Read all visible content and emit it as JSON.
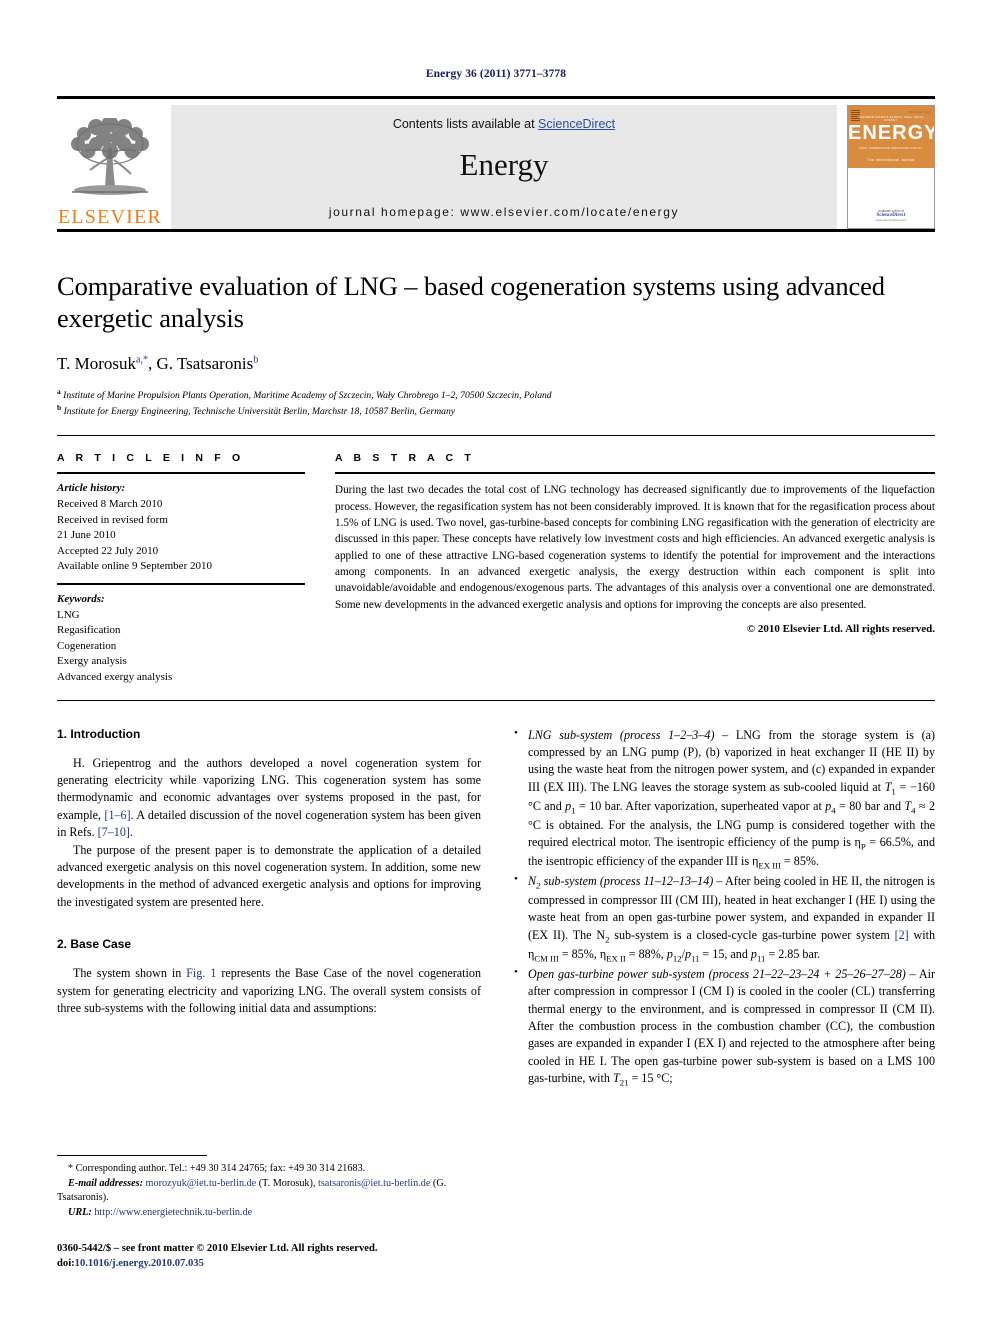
{
  "running_head": "Energy 36 (2011) 3771–3778",
  "masthead": {
    "publisher_name": "ELSEVIER",
    "contents_prefix": "Contents lists available at ",
    "contents_link": "ScienceDirect",
    "journal_title": "Energy",
    "homepage": "journal homepage: www.elsevier.com/locate/energy",
    "cover": {
      "word": "ENERGY",
      "subtitle": "The International Journal",
      "top_microtext": "THERMODYNAMICS   EXERGY   FUEL CELLS   ENERGY",
      "bottom_microtext": "HEAT   COMBUSTION   EMISSIONS   POLICY",
      "corner": "ISSN 0360-5442",
      "avail_line1": "Available online at",
      "avail_line2": "ScienceDirect",
      "avail_line3": "www.sciencedirect.com"
    },
    "accent_orange": "#ef7d1a",
    "link_blue": "#2a4fa2"
  },
  "article": {
    "title": "Comparative evaluation of LNG – based cogeneration systems using advanced exergetic analysis",
    "authors_html": "T. Morosuk<sup>a,</sup><sup>*</sup>, G. Tsatsaronis<sup>b</sup>",
    "affiliation_a": "Institute of Marine Propulsion Plants Operation, Maritime Academy of Szczecin, Wały Chrobrego 1–2, 70500 Szczecin, Poland",
    "affiliation_b": "Institute for Energy Engineering, Technische Universität Berlin, Marchstr 18, 10587 Berlin, Germany"
  },
  "article_info": {
    "heading": "A R T I C L E   I N F O",
    "history_label": "Article history:",
    "history": [
      "Received 8 March 2010",
      "Received in revised form",
      "21 June 2010",
      "Accepted 22 July 2010",
      "Available online 9 September 2010"
    ],
    "keywords_label": "Keywords:",
    "keywords": [
      "LNG",
      "Regasification",
      "Cogeneration",
      "Exergy analysis",
      "Advanced exergy analysis"
    ]
  },
  "abstract": {
    "heading": "A B S T R A C T",
    "text": "During the last two decades the total cost of LNG technology has decreased significantly due to improvements of the liquefaction process. However, the regasification system has not been considerably improved. It is known that for the regasification process about 1.5% of LNG is used. Two novel, gas-turbine-based concepts for combining LNG regasification with the generation of electricity are discussed in this paper. These concepts have relatively low investment costs and high efficiencies. An advanced exergetic analysis is applied to one of these attractive LNG-based cogeneration systems to identify the potential for improvement and the interactions among components. In an advanced exergetic analysis, the exergy destruction within each component is split into unavoidable/avoidable and endogenous/exogenous parts. The advantages of this analysis over a conventional one are demonstrated. Some new developments in the advanced exergetic analysis and options for improving the concepts are also presented.",
    "copyright": "© 2010 Elsevier Ltd. All rights reserved."
  },
  "body": {
    "section1_heading": "1.  Introduction",
    "section1_p1_pre": "H. Griepentrog and the authors developed a novel cogeneration system for generating electricity while vaporizing LNG. This cogeneration system has some thermodynamic and economic advantages over systems proposed in the past, for example, ",
    "section1_p1_ref1": "[1–6]",
    "section1_p1_mid": ". A detailed discussion of the novel cogeneration system has been given in Refs. ",
    "section1_p1_ref2": "[7–10]",
    "section1_p1_post": ".",
    "section1_p2": "The purpose of the present paper is to demonstrate the application of a detailed advanced exergetic analysis on this novel cogeneration system. In addition, some new developments in the method of advanced exergetic analysis and options for improving the investigated system are presented here.",
    "section2_heading": "2.  Base Case",
    "section2_p1_pre": "The system shown in ",
    "section2_p1_ref": "Fig. 1",
    "section2_p1_post": " represents the Base Case of the novel cogeneration system for generating electricity and vaporizing LNG. The overall system consists of three sub-systems with the following initial data and assumptions:"
  },
  "bullets": [
    {
      "name": "lng-sub-system",
      "html": "<span class=\"it\">LNG sub-system (process 1–2–3–4)</span> – LNG from the storage system is (a) compressed by an LNG pump (P), (b) vaporized in heat exchanger II (HE II) by using the waste heat from the nitrogen power system, and (c) expanded in expander III (EX III). The LNG leaves the storage system as sub-cooled liquid at <span class=\"it\">T</span><sub>1</sub> = −160 °C and <span class=\"it\">p</span><sub>1</sub> = 10 bar. After vaporization, superheated vapor at <span class=\"it\">p</span><sub>4</sub> = 80 bar and <span class=\"it\">T</span><sub>4</sub> ≈ 2 °C is obtained. For the analysis, the LNG pump is considered together with the required electrical motor. The isentropic efficiency of the pump is η<sub>P</sub> = 66.5%, and the isentropic efficiency of the expander III is η<sub>EX III</sub> = 85%."
    },
    {
      "name": "n2-sub-system",
      "html": "<span class=\"it\">N</span><sub class=\"it\">2</sub> <span class=\"it\">sub-system (process 11–12–13–14)</span> – After being cooled in HE II, the nitrogen is compressed in compressor III (CM III), heated in heat exchanger I (HE I) using the waste heat from an open gas-turbine power system, and expanded in expander II (EX II). The N<sub>2</sub> sub-system is a closed-cycle gas-turbine power system <span class=\"ref\">[2]</span> with η<sub>CM III</sub> = 85%, η<sub>EX II</sub> = 88%, <span class=\"it\">p</span><sub>12</sub>/<span class=\"it\">p</span><sub>11</sub> = 15, and <span class=\"it\">p</span><sub>11</sub> = 2.85 bar."
    },
    {
      "name": "open-gas-turbine-sub-system",
      "html": "<span class=\"it\">Open gas-turbine power sub-system (process 21–22–23–24 + 25–26–27–28)</span> – Air after compression in compressor I (CM I) is cooled in the cooler (CL) transferring thermal energy to the environment, and is compressed in compressor II (CM II). After the combustion process in the combustion chamber (CC), the combustion gases are expanded in expander I (EX I) and rejected to the atmosphere after being cooled in HE I. The open gas-turbine power sub-system is based on a LMS 100 gas-turbine, with <span class=\"it\">T</span><sub>21</sub> = 15 °C;"
    }
  ],
  "footnotes": {
    "corresponding": "* Corresponding author. Tel.: +49 30 314 24765; fax: +49 30 314 21683.",
    "email_label": "E-mail addresses:",
    "email_1": "morozyuk@iet.tu-berlin.de",
    "email_1_who": "(T. Morosuk),",
    "email_2": "tsatsaronis@iet.tu-berlin.de",
    "email_2_who": "(G. Tsatsaronis).",
    "url_label": "URL:",
    "url": "http://www.energietechnik.tu-berlin.de",
    "imprint_line1": "0360-5442/$ – see front matter © 2010 Elsevier Ltd. All rights reserved.",
    "imprint_doi_label": "doi:",
    "imprint_doi": "10.1016/j.energy.2010.07.035"
  }
}
